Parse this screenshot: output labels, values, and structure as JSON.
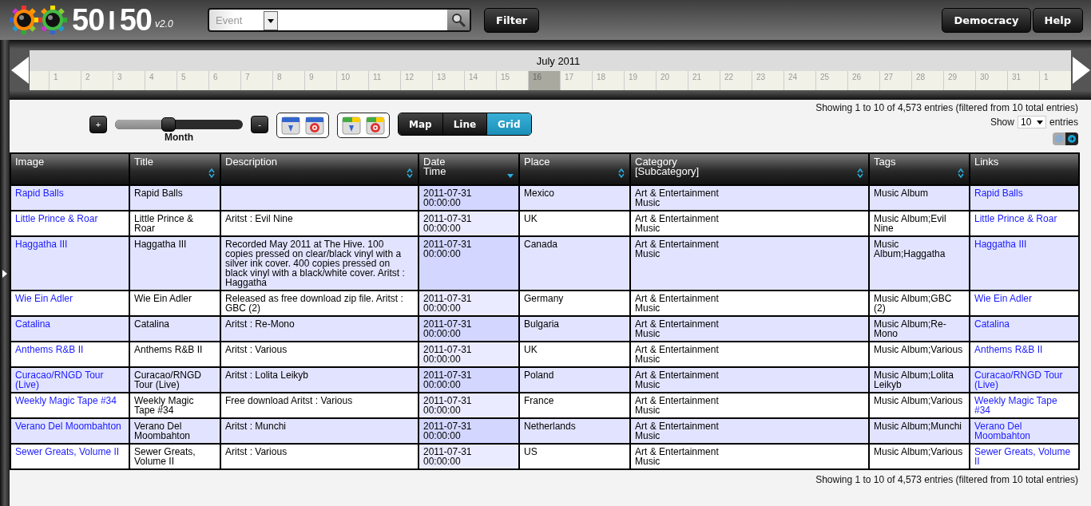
{
  "header": {
    "logo": "50",
    "logo_divider": "I",
    "logo_end": "50",
    "version": "v2.0",
    "search": {
      "category": "Event"
    },
    "filter_button": "Filter",
    "nav_buttons": [
      "Democracy",
      "Help"
    ]
  },
  "timeline": {
    "month": "July 2011",
    "days": [
      {
        "label": "1",
        "selected": false
      },
      {
        "label": "2",
        "selected": false
      },
      {
        "label": "3",
        "selected": false
      },
      {
        "label": "4",
        "selected": false
      },
      {
        "label": "5",
        "selected": false
      },
      {
        "label": "6",
        "selected": false
      },
      {
        "label": "7",
        "selected": false
      },
      {
        "label": "8",
        "selected": false
      },
      {
        "label": "9",
        "selected": false
      },
      {
        "label": "10",
        "selected": false
      },
      {
        "label": "11",
        "selected": false
      },
      {
        "label": "12",
        "selected": false
      },
      {
        "label": "13",
        "selected": false
      },
      {
        "label": "14",
        "selected": false
      },
      {
        "label": "15",
        "selected": false
      },
      {
        "label": "16",
        "selected": true
      },
      {
        "label": "17",
        "selected": false
      },
      {
        "label": "18",
        "selected": false
      },
      {
        "label": "19",
        "selected": false
      },
      {
        "label": "20",
        "selected": false
      },
      {
        "label": "21",
        "selected": false
      },
      {
        "label": "22",
        "selected": false
      },
      {
        "label": "23",
        "selected": false
      },
      {
        "label": "24",
        "selected": false
      },
      {
        "label": "25",
        "selected": false
      },
      {
        "label": "26",
        "selected": false
      },
      {
        "label": "27",
        "selected": false
      },
      {
        "label": "28",
        "selected": false
      },
      {
        "label": "29",
        "selected": false
      },
      {
        "label": "30",
        "selected": false
      },
      {
        "label": "31",
        "selected": false
      },
      {
        "label": "1",
        "selected": false
      }
    ]
  },
  "controls": {
    "zoom_in": "+",
    "zoom_out": "-",
    "zoom": {
      "level": 0.42,
      "label": "Month"
    },
    "views": [
      {
        "label": "Map",
        "selected": false
      },
      {
        "label": "Line",
        "selected": false
      },
      {
        "label": "Grid",
        "selected": true
      }
    ],
    "info": "Showing 1 to 10 of 4,573 entries (filtered from 10 total entries)",
    "show_label": "Show",
    "show_value": "10",
    "entries_label": "entries"
  },
  "table": {
    "columns": [
      {
        "label": "Image",
        "kind": "plain"
      },
      {
        "label": "Title",
        "kind": "sortable"
      },
      {
        "label": "Description",
        "kind": "sortable"
      },
      {
        "label": "Date",
        "sub": "Time",
        "kind": "sorted"
      },
      {
        "label": "Place",
        "kind": "sortable"
      },
      {
        "label": "Category",
        "sub": "[Subcategory]",
        "kind": "sortable"
      },
      {
        "label": "Tags",
        "kind": "sortable"
      },
      {
        "label": "Links",
        "kind": "plain"
      }
    ],
    "rows": [
      {
        "image": "Rapid Balls",
        "title": "Rapid Balls",
        "date": "2011-07-31",
        "time": "00:00:00",
        "place": "Mexico",
        "category": "Art & Entertainment",
        "subcategory": "Music",
        "tags": "Music Album",
        "link": "Rapid Balls"
      },
      {
        "image": "Little Prince & Roar",
        "title": "Little Prince & Roar",
        "description": "Aritst : Evil Nine",
        "date": "2011-07-31",
        "time": "00:00:00",
        "place": "UK",
        "category": "Art & Entertainment",
        "subcategory": "Music",
        "tags": "Music Album;Evil Nine",
        "link": "Little Prince & Roar"
      },
      {
        "image": "Haggatha III",
        "title": "Haggatha III",
        "description": "Recorded May 2011 at The Hive. 100 copies pressed on clear/black vinyl with a silver ink cover. 400 copies pressed on black vinyl with a black/white cover. Aritst : Haggatha",
        "date": "2011-07-31",
        "time": "00:00:00",
        "place": "Canada",
        "category": "Art & Entertainment",
        "subcategory": "Music",
        "tags": "Music Album;Haggatha",
        "link": "Haggatha III"
      },
      {
        "image": "Wie Ein Adler",
        "title": "Wie Ein Adler",
        "description": "Released as free download zip file. Aritst : GBC (2)",
        "date": "2011-07-31",
        "time": "00:00:00",
        "place": "Germany",
        "category": "Art & Entertainment",
        "subcategory": "Music",
        "tags": "Music Album;GBC (2)",
        "link": "Wie Ein Adler"
      },
      {
        "image": "Catalina",
        "title": "Catalina",
        "description": "Aritst : Re-Mono",
        "date": "2011-07-31",
        "time": "00:00:00",
        "place": "Bulgaria",
        "category": "Art & Entertainment",
        "subcategory": "Music",
        "tags": "Music Album;Re-Mono",
        "link": "Catalina"
      },
      {
        "image": "Anthems R&B II",
        "title": "Anthems R&B II",
        "description": "Aritst : Various",
        "date": "2011-07-31",
        "time": "00:00:00",
        "place": "UK",
        "category": "Art & Entertainment",
        "subcategory": "Music",
        "tags": "Music Album;Various",
        "link": "Anthems R&B II"
      },
      {
        "image": "Curacao/RNGD Tour (Live)",
        "title": "Curacao/RNGD Tour (Live)",
        "description": "Aritst : Lolita Leikyb",
        "date": "2011-07-31",
        "time": "00:00:00",
        "place": "Poland",
        "category": "Art & Entertainment",
        "subcategory": "Music",
        "tags": "Music Album;Lolita Leikyb",
        "link": "Curacao/RNGD Tour (Live)"
      },
      {
        "image": "Weekly Magic Tape #34",
        "title": "Weekly Magic Tape #34",
        "description": "Free download Aritst : Various",
        "date": "2011-07-31",
        "time": "00:00:00",
        "place": "France",
        "category": "Art & Entertainment",
        "subcategory": "Music",
        "tags": "Music Album;Various",
        "link": "Weekly Magic Tape #34"
      },
      {
        "image": "Verano Del Moombahton",
        "title": "Verano Del Moombahton",
        "description": "Aritst : Munchi",
        "date": "2011-07-31",
        "time": "00:00:00",
        "place": "Netherlands",
        "category": "Art & Entertainment",
        "subcategory": "Music",
        "tags": "Music Album;Munchi",
        "link": "Verano Del Moombahton"
      },
      {
        "image": "Sewer Greats, Volume II",
        "title": "Sewer Greats, Volume II",
        "description": "Aritst : Various",
        "date": "2011-07-31",
        "time": "00:00:00",
        "place": "US",
        "category": "Art & Entertainment",
        "subcategory": "Music",
        "tags": "Music Album;Various",
        "link": "Sewer Greats, Volume II"
      }
    ]
  },
  "footer_info": "Showing 1 to 10 of 4,573 entries (filtered from 10 total entries)"
}
